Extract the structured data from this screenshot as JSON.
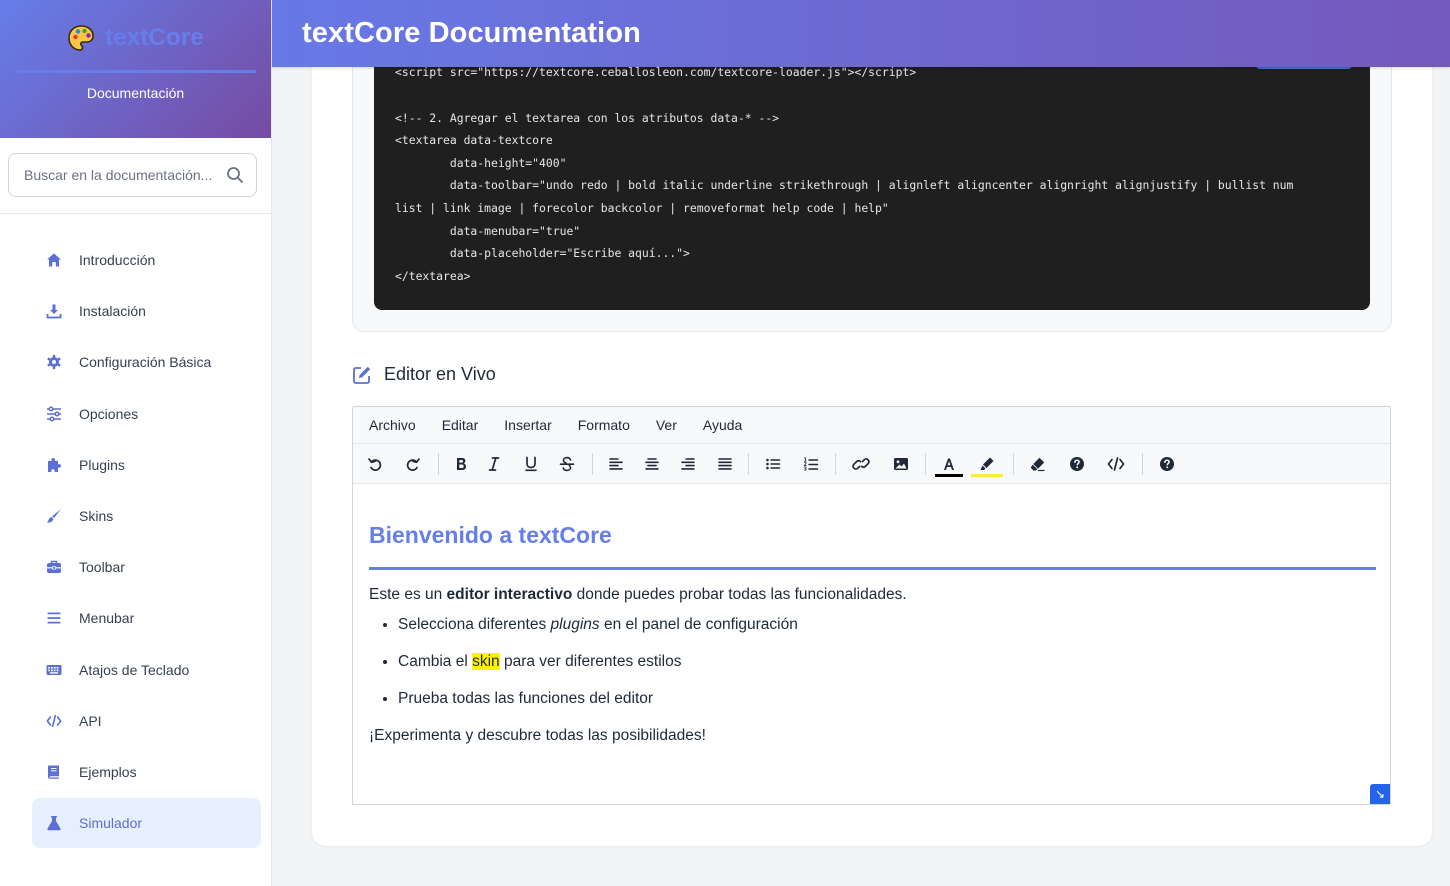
{
  "brand": {
    "name": "textCore",
    "subtitle": "Documentación"
  },
  "search": {
    "placeholder": "Buscar en la documentación..."
  },
  "nav": [
    {
      "label": "Introducción",
      "icon": "home-icon"
    },
    {
      "label": "Instalación",
      "icon": "download-icon"
    },
    {
      "label": "Configuración Básica",
      "icon": "gear-icon"
    },
    {
      "label": "Opciones",
      "icon": "sliders-icon"
    },
    {
      "label": "Plugins",
      "icon": "puzzle-icon"
    },
    {
      "label": "Skins",
      "icon": "brush-icon"
    },
    {
      "label": "Toolbar",
      "icon": "toolbox-icon"
    },
    {
      "label": "Menubar",
      "icon": "menu-icon"
    },
    {
      "label": "Atajos de Teclado",
      "icon": "keyboard-icon"
    },
    {
      "label": "API",
      "icon": "code-icon"
    },
    {
      "label": "Ejemplos",
      "icon": "book-icon"
    },
    {
      "label": "Simulador",
      "icon": "flask-icon",
      "active": true
    }
  ],
  "header": {
    "title": "textCore Documentation"
  },
  "code": {
    "lines": [
      "<script src=\"https://textcore.ceballosleon.com/textcore-loader.js\"></script>",
      "<!-- 2. Agregar el textarea con los atributos data-* -->",
      "<textarea data-textcore",
      "        data-height=\"400\"",
      "        data-toolbar=\"undo redo | bold italic underline strikethrough | alignleft aligncenter alignright alignjustify | bullist num",
      "list | link image | forecolor backcolor | removeformat help code | help\"",
      "        data-menubar=\"true\"",
      "        data-placeholder=\"Escribe aquí...\">",
      "</textarea>"
    ]
  },
  "section": {
    "title": "Editor en Vivo"
  },
  "editor": {
    "menu": [
      "Archivo",
      "Editar",
      "Insertar",
      "Formato",
      "Ver",
      "Ayuda"
    ],
    "heading": "Bienvenido a textCore",
    "intro": {
      "before": "Este es un ",
      "bold": "editor interactivo",
      "after": " donde puedes probar todas las funcionalidades."
    },
    "bullet1": {
      "before": "Selecciona diferentes ",
      "italic": "plugins",
      "after": " en el panel de configuración"
    },
    "bullet2": {
      "before": "Cambia el ",
      "highlight": "skin",
      "after": " para ver diferentes estilos"
    },
    "bullet3": {
      "text": "Prueba todas las funciones del editor"
    },
    "closing": "¡Experimenta y descubre todas las posibilidades!",
    "forecolor": "#000000",
    "backcolor": "#ffeb3b"
  },
  "colors": {
    "accent": "#667eea",
    "accent_dark": "#764ba2",
    "active_bg": "#e6f0fd",
    "code_bg": "#1f1f1f"
  }
}
